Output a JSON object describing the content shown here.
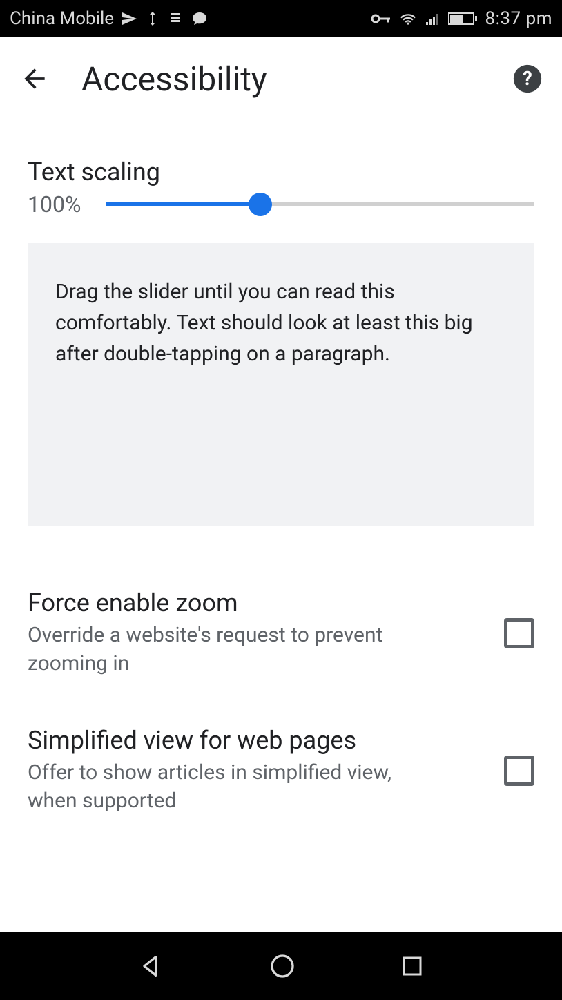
{
  "status": {
    "carrier": "China Mobile",
    "time": "8:37 pm"
  },
  "header": {
    "title": "Accessibility"
  },
  "text_scaling": {
    "label": "Text scaling",
    "value_text": "100%",
    "percent": 36,
    "preview": "Drag the slider until you can read this comfortably. Text should look at least this big after double-tapping on a paragraph."
  },
  "settings": {
    "force_zoom": {
      "title": "Force enable zoom",
      "subtitle": "Override a website's request to prevent zooming in",
      "checked": false
    },
    "simplified_view": {
      "title": "Simplified view for web pages",
      "subtitle": "Offer to show articles in simplified view, when supported",
      "checked": false
    }
  }
}
